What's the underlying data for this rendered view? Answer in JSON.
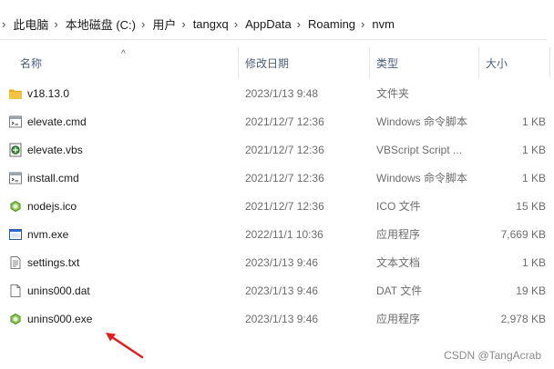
{
  "breadcrumb": [
    "此电脑",
    "本地磁盘 (C:)",
    "用户",
    "tangxq",
    "AppData",
    "Roaming",
    "nvm"
  ],
  "columns": {
    "name": "名称",
    "date": "修改日期",
    "type": "类型",
    "size": "大小"
  },
  "files": [
    {
      "name": "v18.13.0",
      "date": "2023/1/13 9:48",
      "type": "文件夹",
      "size": "",
      "icon": "folder-icon"
    },
    {
      "name": "elevate.cmd",
      "date": "2021/12/7 12:36",
      "type": "Windows 命令脚本",
      "size": "1 KB",
      "icon": "cmd-file-icon"
    },
    {
      "name": "elevate.vbs",
      "date": "2021/12/7 12:36",
      "type": "VBScript Script ...",
      "size": "1 KB",
      "icon": "vbs-file-icon"
    },
    {
      "name": "install.cmd",
      "date": "2021/12/7 12:36",
      "type": "Windows 命令脚本",
      "size": "1 KB",
      "icon": "cmd-file-icon"
    },
    {
      "name": "nodejs.ico",
      "date": "2021/12/7 12:36",
      "type": "ICO 文件",
      "size": "15 KB",
      "icon": "nodejs-icon"
    },
    {
      "name": "nvm.exe",
      "date": "2022/11/1 10:36",
      "type": "应用程序",
      "size": "7,669 KB",
      "icon": "exe-window-icon"
    },
    {
      "name": "settings.txt",
      "date": "2023/1/13 9:46",
      "type": "文本文档",
      "size": "1 KB",
      "icon": "text-file-icon"
    },
    {
      "name": "unins000.dat",
      "date": "2023/1/13 9:46",
      "type": "DAT 文件",
      "size": "19 KB",
      "icon": "blank-file-icon"
    },
    {
      "name": "unins000.exe",
      "date": "2023/1/13 9:46",
      "type": "应用程序",
      "size": "2,978 KB",
      "icon": "nodejs-icon"
    }
  ],
  "watermark": "CSDN @TangAcrab",
  "colors": {
    "folder": "#f5c342",
    "nodejs_green": "#5fa04e",
    "arrow": "#e02020",
    "header_text": "#4c607a"
  }
}
